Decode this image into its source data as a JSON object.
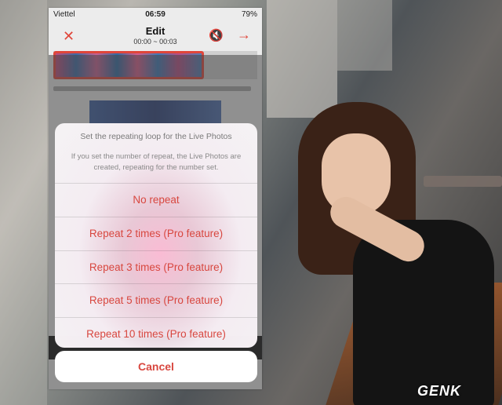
{
  "status_bar": {
    "carrier": "Viettel",
    "time": "06:59",
    "battery": "79%"
  },
  "nav": {
    "title": "Edit",
    "range": "00:00 ~ 00:03",
    "close_icon": "close-icon",
    "mute_icon": "mute-icon",
    "next_icon": "arrow-right-icon"
  },
  "sheet": {
    "title": "Set the repeating loop for the Live Photos",
    "message": "If you set the number of repeat, the Live Photos are created, repeating for the number set.",
    "options": [
      "No repeat",
      "Repeat 2 times (Pro feature)",
      "Repeat 3 times (Pro feature)",
      "Repeat 5 times (Pro feature)",
      "Repeat 10 times (Pro feature)"
    ],
    "cancel": "Cancel"
  },
  "watermark": "GENK",
  "colors": {
    "accent": "#d8473f"
  }
}
